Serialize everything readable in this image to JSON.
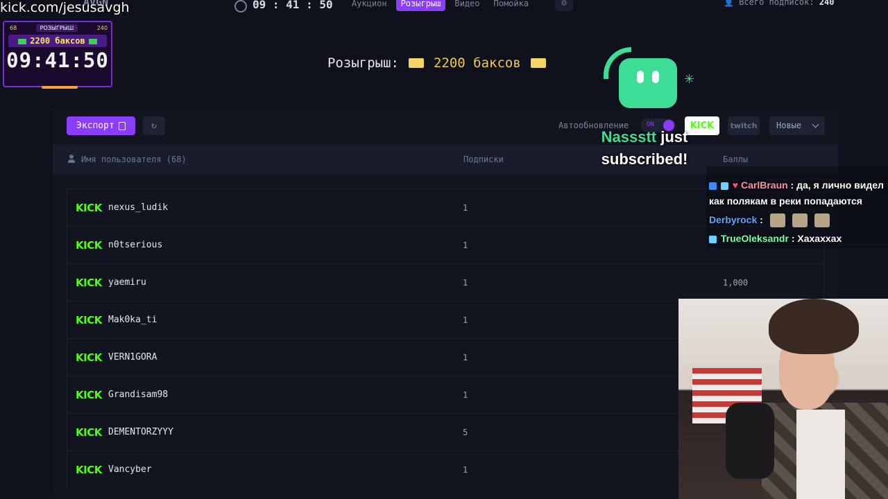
{
  "watermark": "kick.com/jesusavgh",
  "topbar": {
    "brand": "AVGN",
    "clock": "09 : 41 : 50",
    "nav": [
      "Аукцион",
      "Розыгрыш",
      "Видео",
      "Помойка"
    ],
    "active_nav": 1,
    "subs_label": "Всего подписок:",
    "subs_count": "240"
  },
  "widget": {
    "left_count": "68",
    "badge": "РОЗЫГРЫШ",
    "right_count": "240",
    "prize": "2200 баксов",
    "time": "09:41:50"
  },
  "title": {
    "label": "Розыгрыш:",
    "amount": "2200 баксов"
  },
  "toolbar": {
    "export_label": "Экспорт",
    "auto_label": "Автообновление",
    "toggle_text": "ON",
    "kick_label": "KICK",
    "twitch_label": "twitch",
    "sort_value": "Новые"
  },
  "table": {
    "col_user": "Имя пользователя (68)",
    "col_subs": "Подписки",
    "col_points": "Баллы",
    "rows": [
      {
        "name": "nexus_ludik",
        "subs": "1",
        "points": ""
      },
      {
        "name": "n0tserious",
        "subs": "1",
        "points": ""
      },
      {
        "name": "yaemiru",
        "subs": "1",
        "points": "1,000"
      },
      {
        "name": "Mak0ka_ti",
        "subs": "1",
        "points": ""
      },
      {
        "name": "VERN1GORA",
        "subs": "1",
        "points": ""
      },
      {
        "name": "Grandisam98",
        "subs": "1",
        "points": ""
      },
      {
        "name": "DEMENTORZYYY",
        "subs": "5",
        "points": ""
      },
      {
        "name": "Vancyber",
        "subs": "1",
        "points": ""
      }
    ]
  },
  "alert": {
    "who": "Nassstt",
    "rest1": " just",
    "rest2": "subscribed!"
  },
  "chat": [
    {
      "user": "CarlBraun",
      "color": "#ff8fa3",
      "text": "да, я лично видел как полякам в реки попадаются"
    },
    {
      "user": "Derbyrock",
      "color": "#5aa8ff",
      "text": ""
    },
    {
      "user": "TrueOleksandr",
      "color": "#7cffb0",
      "text": "Хахаххах"
    }
  ],
  "colors": {
    "accent": "#8b3dff",
    "kick": "#53fc18"
  }
}
